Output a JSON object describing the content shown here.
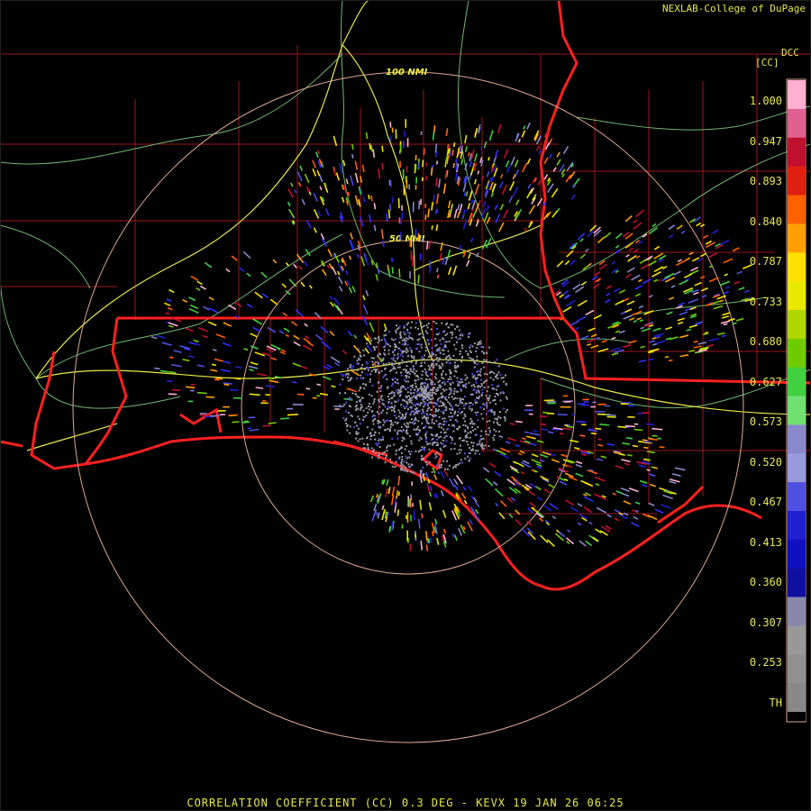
{
  "credit": "NEXLAB-College of DuPage",
  "site_tag": "DCC",
  "unit_label": "[CC]",
  "footer": "CORRELATION COEFFICIENT (CC) 0.3 DEG - KEVX 19 JAN 26 06:25",
  "range_rings": {
    "inner_label": "50 NMI",
    "outer_label": "100 NMI"
  },
  "colorbar": {
    "ticks": [
      "1.000",
      "0.947",
      "0.893",
      "0.840",
      "0.787",
      "0.733",
      "0.680",
      "0.627",
      "0.573",
      "0.520",
      "0.467",
      "0.413",
      "0.360",
      "0.307",
      "0.253",
      "TH"
    ],
    "colors": [
      "#ffb0d0",
      "#e06090",
      "#c01030",
      "#e02010",
      "#ff6000",
      "#ffa000",
      "#ffe000",
      "#e8e800",
      "#b0d800",
      "#70cc00",
      "#40d040",
      "#70e070",
      "#8888cc",
      "#9999dd",
      "#5050e0",
      "#2020d0",
      "#1010c0",
      "#1010a0",
      "#8888aa",
      "#999999",
      "#909090",
      "#888888"
    ],
    "colors_note_only": ""
  },
  "colors": {
    "state_borders": "#ff2020",
    "county_lines": "#a01818",
    "roads": "#80c080",
    "highways": "#e8e84a",
    "rings": "#e0a890",
    "frame": "#e0a890"
  }
}
